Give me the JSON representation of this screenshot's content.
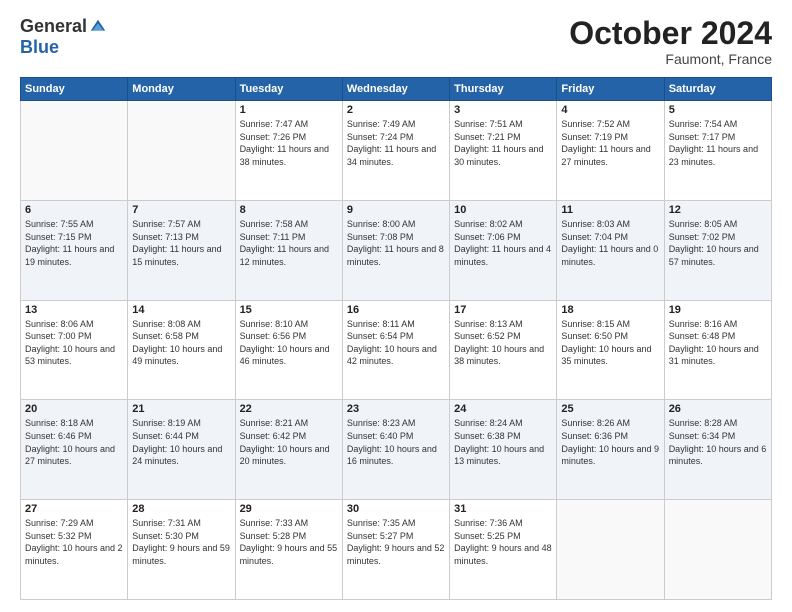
{
  "header": {
    "logo": {
      "general": "General",
      "blue": "Blue"
    },
    "title": "October 2024",
    "location": "Faumont, France"
  },
  "weekdays": [
    "Sunday",
    "Monday",
    "Tuesday",
    "Wednesday",
    "Thursday",
    "Friday",
    "Saturday"
  ],
  "weeks": [
    [
      {
        "day": "",
        "sunrise": "",
        "sunset": "",
        "daylight": ""
      },
      {
        "day": "",
        "sunrise": "",
        "sunset": "",
        "daylight": ""
      },
      {
        "day": "1",
        "sunrise": "Sunrise: 7:47 AM",
        "sunset": "Sunset: 7:26 PM",
        "daylight": "Daylight: 11 hours and 38 minutes."
      },
      {
        "day": "2",
        "sunrise": "Sunrise: 7:49 AM",
        "sunset": "Sunset: 7:24 PM",
        "daylight": "Daylight: 11 hours and 34 minutes."
      },
      {
        "day": "3",
        "sunrise": "Sunrise: 7:51 AM",
        "sunset": "Sunset: 7:21 PM",
        "daylight": "Daylight: 11 hours and 30 minutes."
      },
      {
        "day": "4",
        "sunrise": "Sunrise: 7:52 AM",
        "sunset": "Sunset: 7:19 PM",
        "daylight": "Daylight: 11 hours and 27 minutes."
      },
      {
        "day": "5",
        "sunrise": "Sunrise: 7:54 AM",
        "sunset": "Sunset: 7:17 PM",
        "daylight": "Daylight: 11 hours and 23 minutes."
      }
    ],
    [
      {
        "day": "6",
        "sunrise": "Sunrise: 7:55 AM",
        "sunset": "Sunset: 7:15 PM",
        "daylight": "Daylight: 11 hours and 19 minutes."
      },
      {
        "day": "7",
        "sunrise": "Sunrise: 7:57 AM",
        "sunset": "Sunset: 7:13 PM",
        "daylight": "Daylight: 11 hours and 15 minutes."
      },
      {
        "day": "8",
        "sunrise": "Sunrise: 7:58 AM",
        "sunset": "Sunset: 7:11 PM",
        "daylight": "Daylight: 11 hours and 12 minutes."
      },
      {
        "day": "9",
        "sunrise": "Sunrise: 8:00 AM",
        "sunset": "Sunset: 7:08 PM",
        "daylight": "Daylight: 11 hours and 8 minutes."
      },
      {
        "day": "10",
        "sunrise": "Sunrise: 8:02 AM",
        "sunset": "Sunset: 7:06 PM",
        "daylight": "Daylight: 11 hours and 4 minutes."
      },
      {
        "day": "11",
        "sunrise": "Sunrise: 8:03 AM",
        "sunset": "Sunset: 7:04 PM",
        "daylight": "Daylight: 11 hours and 0 minutes."
      },
      {
        "day": "12",
        "sunrise": "Sunrise: 8:05 AM",
        "sunset": "Sunset: 7:02 PM",
        "daylight": "Daylight: 10 hours and 57 minutes."
      }
    ],
    [
      {
        "day": "13",
        "sunrise": "Sunrise: 8:06 AM",
        "sunset": "Sunset: 7:00 PM",
        "daylight": "Daylight: 10 hours and 53 minutes."
      },
      {
        "day": "14",
        "sunrise": "Sunrise: 8:08 AM",
        "sunset": "Sunset: 6:58 PM",
        "daylight": "Daylight: 10 hours and 49 minutes."
      },
      {
        "day": "15",
        "sunrise": "Sunrise: 8:10 AM",
        "sunset": "Sunset: 6:56 PM",
        "daylight": "Daylight: 10 hours and 46 minutes."
      },
      {
        "day": "16",
        "sunrise": "Sunrise: 8:11 AM",
        "sunset": "Sunset: 6:54 PM",
        "daylight": "Daylight: 10 hours and 42 minutes."
      },
      {
        "day": "17",
        "sunrise": "Sunrise: 8:13 AM",
        "sunset": "Sunset: 6:52 PM",
        "daylight": "Daylight: 10 hours and 38 minutes."
      },
      {
        "day": "18",
        "sunrise": "Sunrise: 8:15 AM",
        "sunset": "Sunset: 6:50 PM",
        "daylight": "Daylight: 10 hours and 35 minutes."
      },
      {
        "day": "19",
        "sunrise": "Sunrise: 8:16 AM",
        "sunset": "Sunset: 6:48 PM",
        "daylight": "Daylight: 10 hours and 31 minutes."
      }
    ],
    [
      {
        "day": "20",
        "sunrise": "Sunrise: 8:18 AM",
        "sunset": "Sunset: 6:46 PM",
        "daylight": "Daylight: 10 hours and 27 minutes."
      },
      {
        "day": "21",
        "sunrise": "Sunrise: 8:19 AM",
        "sunset": "Sunset: 6:44 PM",
        "daylight": "Daylight: 10 hours and 24 minutes."
      },
      {
        "day": "22",
        "sunrise": "Sunrise: 8:21 AM",
        "sunset": "Sunset: 6:42 PM",
        "daylight": "Daylight: 10 hours and 20 minutes."
      },
      {
        "day": "23",
        "sunrise": "Sunrise: 8:23 AM",
        "sunset": "Sunset: 6:40 PM",
        "daylight": "Daylight: 10 hours and 16 minutes."
      },
      {
        "day": "24",
        "sunrise": "Sunrise: 8:24 AM",
        "sunset": "Sunset: 6:38 PM",
        "daylight": "Daylight: 10 hours and 13 minutes."
      },
      {
        "day": "25",
        "sunrise": "Sunrise: 8:26 AM",
        "sunset": "Sunset: 6:36 PM",
        "daylight": "Daylight: 10 hours and 9 minutes."
      },
      {
        "day": "26",
        "sunrise": "Sunrise: 8:28 AM",
        "sunset": "Sunset: 6:34 PM",
        "daylight": "Daylight: 10 hours and 6 minutes."
      }
    ],
    [
      {
        "day": "27",
        "sunrise": "Sunrise: 7:29 AM",
        "sunset": "Sunset: 5:32 PM",
        "daylight": "Daylight: 10 hours and 2 minutes."
      },
      {
        "day": "28",
        "sunrise": "Sunrise: 7:31 AM",
        "sunset": "Sunset: 5:30 PM",
        "daylight": "Daylight: 9 hours and 59 minutes."
      },
      {
        "day": "29",
        "sunrise": "Sunrise: 7:33 AM",
        "sunset": "Sunset: 5:28 PM",
        "daylight": "Daylight: 9 hours and 55 minutes."
      },
      {
        "day": "30",
        "sunrise": "Sunrise: 7:35 AM",
        "sunset": "Sunset: 5:27 PM",
        "daylight": "Daylight: 9 hours and 52 minutes."
      },
      {
        "day": "31",
        "sunrise": "Sunrise: 7:36 AM",
        "sunset": "Sunset: 5:25 PM",
        "daylight": "Daylight: 9 hours and 48 minutes."
      },
      {
        "day": "",
        "sunrise": "",
        "sunset": "",
        "daylight": ""
      },
      {
        "day": "",
        "sunrise": "",
        "sunset": "",
        "daylight": ""
      }
    ]
  ]
}
